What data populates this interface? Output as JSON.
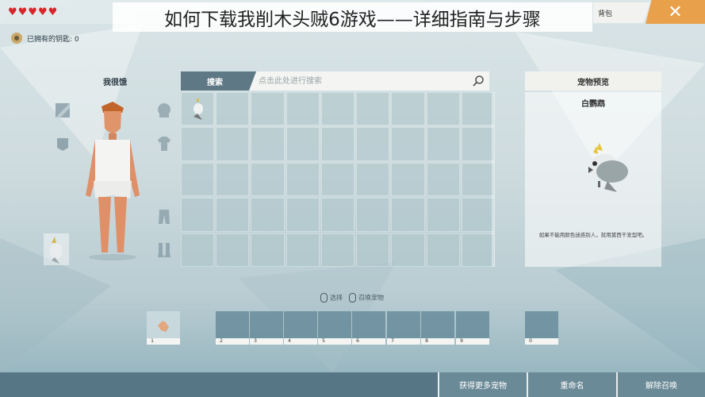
{
  "hud": {
    "hearts": "♥♥♥♥♥",
    "keys_label": "已拥有的钥匙: 0",
    "bag_tab": "背包",
    "close_symbol": "✕"
  },
  "banner": {
    "title": "如何下载我削木头贼6游戏——详细指南与步骤"
  },
  "character": {
    "title": "我很饿"
  },
  "inventory": {
    "search_tab": "搜索",
    "search_placeholder": "点击此处进行搜索",
    "cells": 45,
    "items": [
      {
        "cell": 0,
        "icon": "cockatoo-pet-icon"
      }
    ]
  },
  "preview": {
    "header": "宠物预览",
    "pet_name": "白鹦鹉",
    "description": "如果不能用颜色迷惑别人，就用莫西干发型吧。"
  },
  "hints": {
    "select": "选择",
    "summon": "召唤宠物"
  },
  "hotbar": {
    "slots": [
      "1",
      "2",
      "3",
      "4",
      "5",
      "6",
      "7",
      "8",
      "9",
      "0"
    ]
  },
  "bottom_bar": {
    "more_pets": "获得更多宠物",
    "rename": "重命名",
    "dismiss": "解除召唤"
  },
  "colors": {
    "accent": "#e9a04a",
    "panel_dark": "#5e7886",
    "bottom_bar": "#567685"
  }
}
